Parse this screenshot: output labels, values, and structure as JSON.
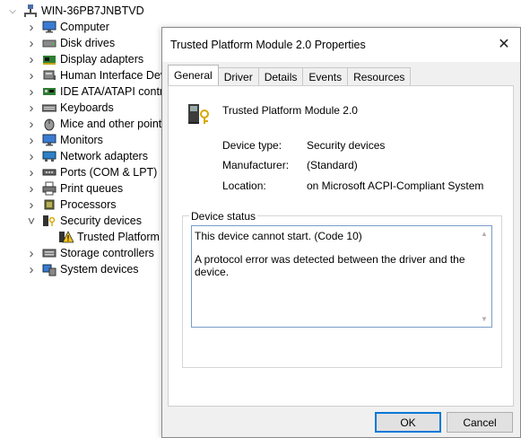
{
  "tree": {
    "root": {
      "label": "WIN-36PB7JNBTVD",
      "icon": "computer-root-icon"
    },
    "items": [
      {
        "label": "Computer",
        "icon": "monitor-icon",
        "expanded": false
      },
      {
        "label": "Disk drives",
        "icon": "disk-drive-icon",
        "expanded": false
      },
      {
        "label": "Display adapters",
        "icon": "display-adapter-icon",
        "expanded": false
      },
      {
        "label": "Human Interface Devi",
        "icon": "hid-icon",
        "expanded": false
      },
      {
        "label": "IDE ATA/ATAPI contro",
        "icon": "ide-controller-icon",
        "expanded": false
      },
      {
        "label": "Keyboards",
        "icon": "keyboard-icon",
        "expanded": false
      },
      {
        "label": "Mice and other pointi",
        "icon": "mouse-icon",
        "expanded": false
      },
      {
        "label": "Monitors",
        "icon": "monitor-icon",
        "expanded": false
      },
      {
        "label": "Network adapters",
        "icon": "network-adapter-icon",
        "expanded": false
      },
      {
        "label": "Ports (COM & LPT)",
        "icon": "port-icon",
        "expanded": false
      },
      {
        "label": "Print queues",
        "icon": "printer-icon",
        "expanded": false
      },
      {
        "label": "Processors",
        "icon": "processor-icon",
        "expanded": false
      },
      {
        "label": "Security devices",
        "icon": "security-device-icon",
        "expanded": true
      },
      {
        "label": "Trusted Platform M",
        "icon": "warning-icon",
        "child": true
      },
      {
        "label": "Storage controllers",
        "icon": "storage-controller-icon",
        "expanded": false
      },
      {
        "label": "System devices",
        "icon": "system-device-icon",
        "expanded": false
      }
    ]
  },
  "dialog": {
    "title": "Trusted Platform Module 2.0 Properties",
    "close_glyph": "✕",
    "tabs": [
      "General",
      "Driver",
      "Details",
      "Events",
      "Resources"
    ],
    "active_tab": "General",
    "device_name": "Trusted Platform Module 2.0",
    "properties": {
      "type_label": "Device type:",
      "type_value": "Security devices",
      "manufacturer_label": "Manufacturer:",
      "manufacturer_value": "(Standard)",
      "location_label": "Location:",
      "location_value": "on Microsoft ACPI-Compliant System"
    },
    "status": {
      "legend": "Device status",
      "line1": "This device cannot start. (Code 10)",
      "line2": "A protocol error was detected between the driver and the device."
    },
    "buttons": {
      "ok": "OK",
      "cancel": "Cancel"
    }
  },
  "colors": {
    "accent": "#0078d7",
    "warning": "#f5c518"
  }
}
